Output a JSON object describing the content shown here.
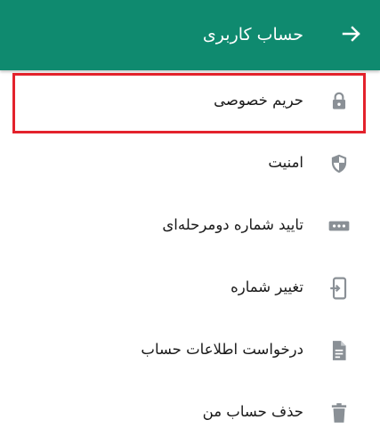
{
  "header": {
    "title": "حساب کاربری",
    "back_icon": "arrow-right-icon",
    "bg_color": "#0f8a6f"
  },
  "items": [
    {
      "label": "حریم خصوصی",
      "icon": "lock-icon"
    },
    {
      "label": "امنیت",
      "icon": "shield-icon"
    },
    {
      "label": "تایید شماره دومرحله‌ای",
      "icon": "dots-icon"
    },
    {
      "label": "تغییر شماره",
      "icon": "phone-change-icon"
    },
    {
      "label": "درخواست اطلاعات حساب",
      "icon": "document-icon"
    },
    {
      "label": "حذف حساب من",
      "icon": "trash-icon"
    }
  ],
  "highlight_color": "#e3222c",
  "icon_color": "#8a9096"
}
